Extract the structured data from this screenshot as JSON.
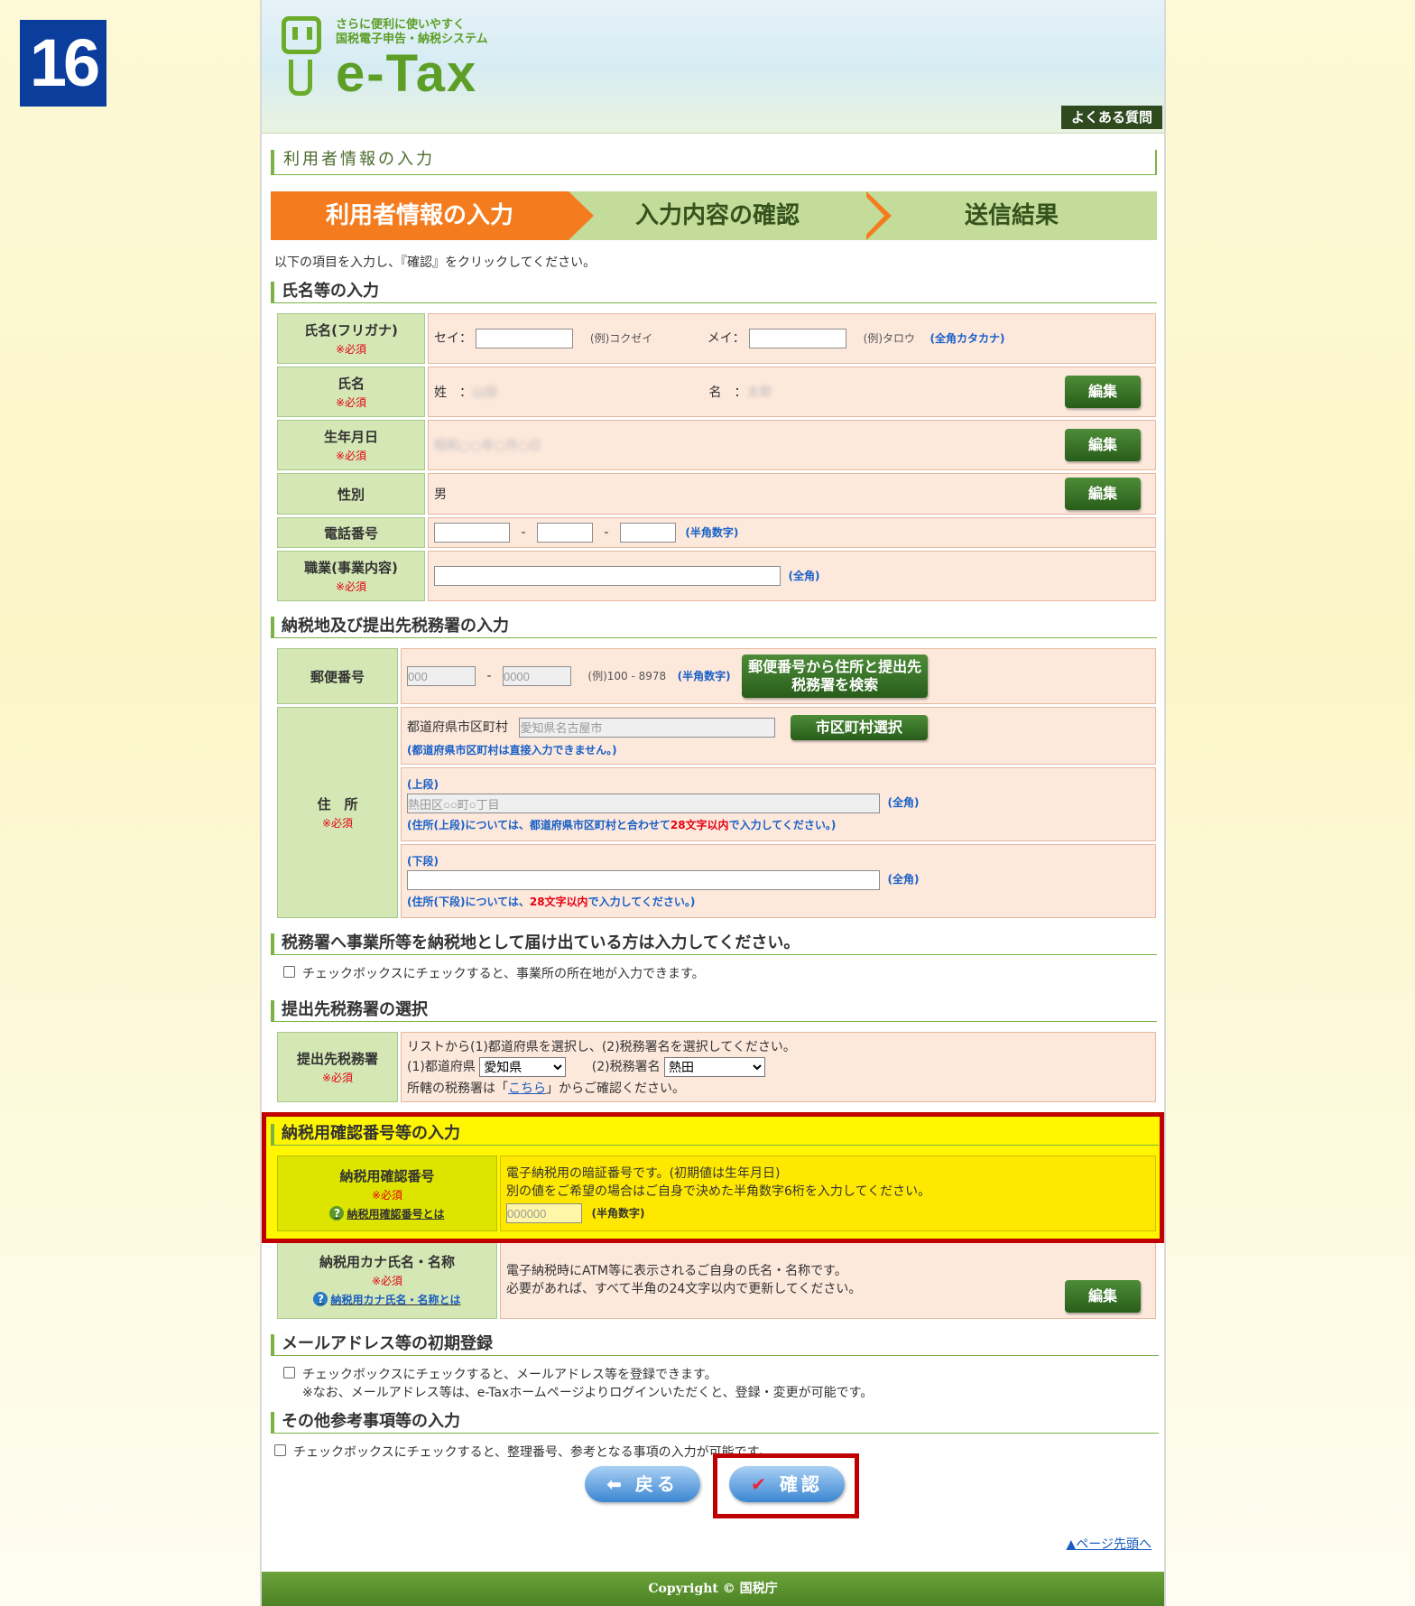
{
  "step_number": "16",
  "header": {
    "tagline_line1": "さらに便利に使いやすく",
    "tagline_line2": "国税電子申告・納税システム",
    "logo_text": "e-Tax",
    "faq": "よくある質問"
  },
  "page_title": "利用者情報の入力",
  "steps": [
    "利用者情報の入力",
    "入力内容の確認",
    "送信結果"
  ],
  "instruction": "以下の項目を入力し、『確認』をクリックしてください。",
  "required": "※必須",
  "edit": "編集",
  "section_name": {
    "title": "氏名等の入力",
    "kana_label": "氏名(フリガナ)",
    "sei_label": "セイ：",
    "sei_example": "(例)コクゼイ",
    "mei_label": "メイ：",
    "mei_example": "(例)タロウ",
    "kana_hint": "(全角カタカナ)",
    "name_label": "氏名",
    "surname_label": "姓　：",
    "surname_value": "山田",
    "given_label": "名　：",
    "given_value": "太郎",
    "birth_label": "生年月日",
    "birth_value": "昭和○○年○月○日",
    "gender_label": "性別",
    "gender_value": "男",
    "phone_label": "電話番号",
    "phone_sep": "-",
    "phone_hint": "(半角数字)",
    "job_label": "職業(事業内容)",
    "job_hint": "(全角)"
  },
  "section_address": {
    "title": "納税地及び提出先税務署の入力",
    "postal_label": "郵便番号",
    "postal1": "000",
    "postal2": "0000",
    "postal_sep": "-",
    "postal_example": "(例)100 - 8978",
    "postal_hint": "(半角数字)",
    "postal_search": "郵便番号から住所と提出先税務署を検索",
    "address_label": "住　所",
    "city_label": "都道府県市区町村",
    "city_value": "愛知県名古屋市",
    "city_button": "市区町村選択",
    "city_note": "(都道府県市区町村は直接入力できません。)",
    "upper_label": "(上段)",
    "upper_value": "熱田区○○町○丁目",
    "upper_hint": "(全角)",
    "upper_note_a": "(住所(上段)については、都道府県市区町村と合わせて",
    "upper_note_b": "28文字以内",
    "upper_note_c": "で入力してください。)",
    "lower_label": "(下段)",
    "lower_hint": "(全角)",
    "lower_note_a": "(住所(下段)については、",
    "lower_note_b": "28文字以内",
    "lower_note_c": "で入力してください。)"
  },
  "section_business": {
    "title": "税務署へ事業所等を納税地として届け出ている方は入力してください。",
    "checkbox": "チェックボックスにチェックすると、事業所の所在地が入力できます。"
  },
  "section_office": {
    "title": "提出先税務署の選択",
    "label": "提出先税務署",
    "line1": "リストから(1)都道府県を選択し、(2)税務署名を選択してください。",
    "pref_label": "(1)都道府県",
    "pref_value": "愛知県",
    "office_label": "(2)税務署名",
    "office_value": "熱田",
    "line3_a": "所轄の税務署は「",
    "line3_link": "こちら",
    "line3_b": "」からご確認ください。"
  },
  "section_pin": {
    "title": "納税用確認番号等の入力",
    "label": "納税用確認番号",
    "help": "納税用確認番号とは",
    "line1": "電子納税用の暗証番号です。(初期値は生年月日)",
    "line2": "別の値をご希望の場合はご自身で決めた半角数字6桁を入力してください。",
    "value": "000000",
    "hint": "(半角数字)",
    "kana_label": "納税用カナ氏名・名称",
    "kana_help": "納税用カナ氏名・名称とは",
    "kana_line1": "電子納税時にATM等に表示されるご自身の氏名・名称です。",
    "kana_line2": "必要があれば、すべて半角の24文字以内で更新してください。"
  },
  "section_mail": {
    "title": "メールアドレス等の初期登録",
    "line1": "チェックボックスにチェックすると、メールアドレス等を登録できます。",
    "line2": "※なお、メールアドレス等は、e-Taxホームページよりログインいただくと、登録・変更が可能です。"
  },
  "section_other": {
    "title": "その他参考事項等の入力",
    "checkbox": "チェックボックスにチェックすると、整理番号、参考となる事項の入力が可能です。"
  },
  "buttons": {
    "back": "戻る",
    "confirm": "確認"
  },
  "page_top": "ページ先頭へ",
  "footer": "Copyright © 国税庁",
  "colors": {
    "accent_orange": "#f47c1e",
    "header_green": "#6bac2b",
    "highlight_red": "#c00000",
    "highlight_yellow": "#fff600"
  }
}
